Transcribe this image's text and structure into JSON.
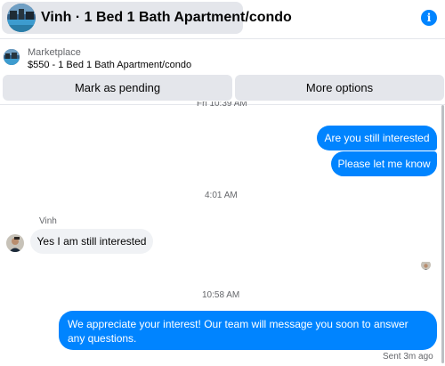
{
  "header": {
    "title": "Vinh · 1 Bed 1 Bath Apartment/condo",
    "info_icon": "info-icon",
    "info_glyph": "i"
  },
  "listing": {
    "label": "Marketplace",
    "title": "$550 - 1 Bed 1 Bath Apartment/condo"
  },
  "actions": {
    "mark_pending": "Mark as pending",
    "more_options": "More options"
  },
  "conversation": {
    "timestamps": [
      "Fri 10:39 AM",
      "4:01 AM",
      "10:58 AM"
    ],
    "outgoing_1": "Are you still interested",
    "outgoing_2": "Please let me know",
    "sender_name": "Vinh",
    "incoming_1": "Yes I am still interested",
    "outgoing_3": "We appreciate your interest! Our team will message you soon to answer any questions.",
    "status": "Sent 3m ago"
  },
  "colors": {
    "accent": "#0084ff",
    "outgoing_bubble": "#0084ff",
    "incoming_bubble": "#f0f2f5",
    "button_bg": "#e4e6eb",
    "secondary_text": "#65676b"
  }
}
